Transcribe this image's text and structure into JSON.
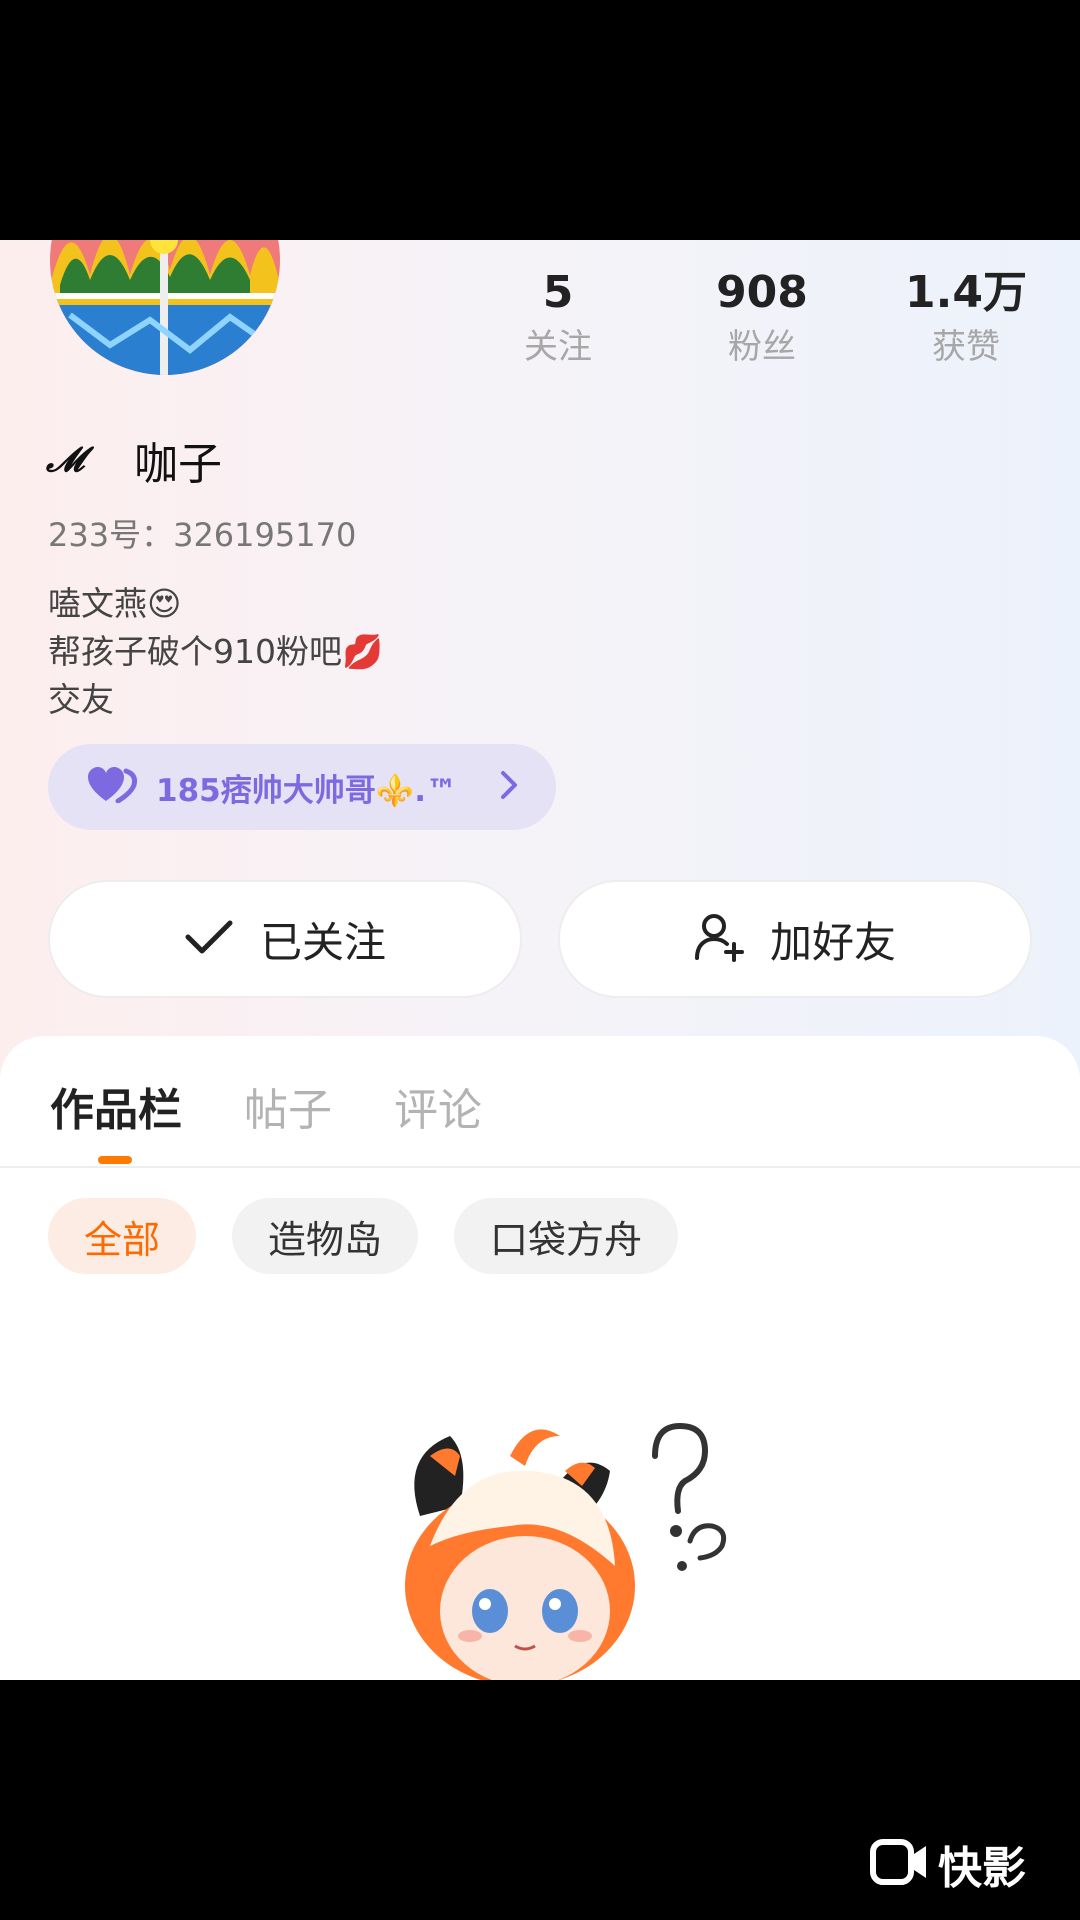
{
  "stats": [
    {
      "value": "5",
      "label": "关注"
    },
    {
      "value": "908",
      "label": "粉丝"
    },
    {
      "value": "1.4万",
      "label": "获赞"
    }
  ],
  "profile": {
    "logo": "𝓜",
    "name": "咖子",
    "uid": "233号：326195170",
    "bio": [
      "嗑文燕😍",
      "帮孩子破个910粉吧💋",
      "交友"
    ]
  },
  "badge": {
    "text": "185痞帅大帅哥⚜️.™"
  },
  "actions": {
    "followed_label": "已关注",
    "add_friend_label": "加好友"
  },
  "tabs": [
    "作品栏",
    "帖子",
    "评论"
  ],
  "chips": [
    "全部",
    "造物岛",
    "口袋方舟"
  ],
  "watermark": {
    "text": "快影"
  },
  "colors": {
    "accent": "#ff7a00",
    "badge_text": "#7d6ae0",
    "badge_bg": "#e6e2f6"
  }
}
